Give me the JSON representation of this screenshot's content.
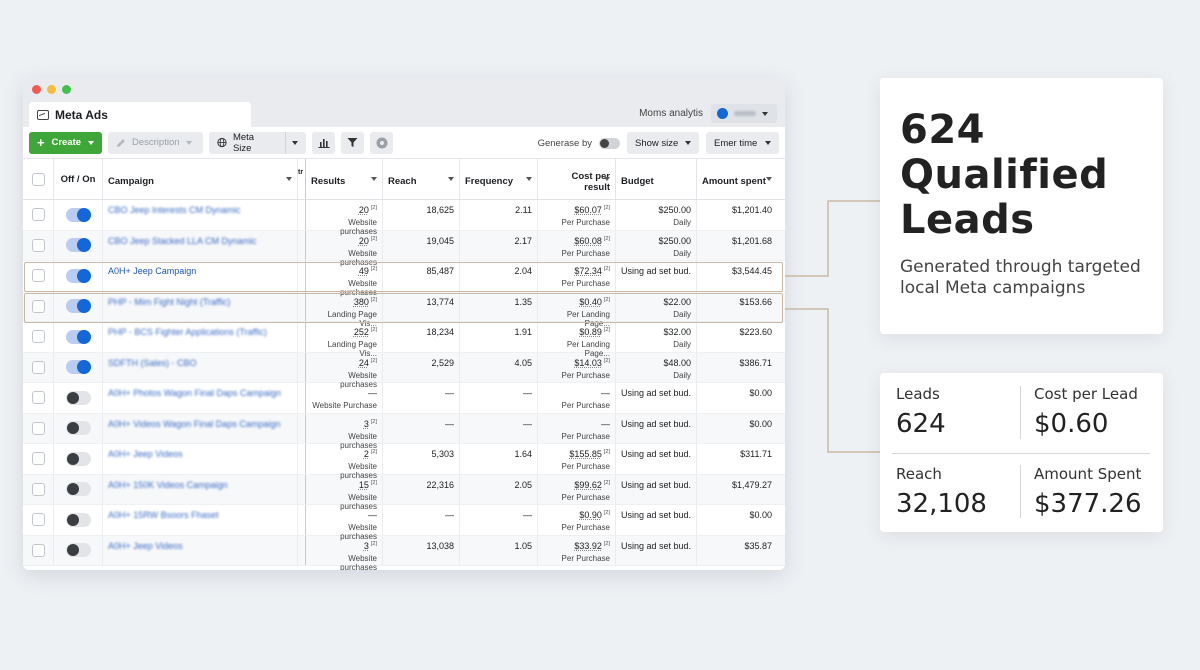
{
  "window": {
    "tab_title": "Meta Ads",
    "account_label": "Moms analytis"
  },
  "toolbar": {
    "create_label": "Create",
    "description_label": "Description",
    "meta_size_label": "Meta Size",
    "generase_label": "Generase by",
    "show_size_label": "Show size",
    "emer_time_label": "Emer time"
  },
  "table": {
    "columns": {
      "onoff": "Off / On",
      "campaign": "Campaign",
      "narrow": "tr",
      "results": "Results",
      "reach": "Reach",
      "frequency": "Frequency",
      "cpr": "Cost per result",
      "budget": "Budget",
      "amount": "Amount spent"
    },
    "rows": [
      {
        "on": true,
        "campaign": "CBO Jeep Interests CM Dynamic",
        "blur": true,
        "results": "20",
        "results_sub": "Website purchases",
        "reach": "18,625",
        "frequency": "2.11",
        "cpr": "$60.07",
        "cpr_sub": "Per Purchase",
        "budget": "$250.00",
        "budget_sub": "Daily",
        "amount": "$1,201.40"
      },
      {
        "on": true,
        "campaign": "CBO Jeep Stacked LLA CM Dynamic",
        "blur": true,
        "results": "20",
        "results_sub": "Website purchases",
        "reach": "19,045",
        "frequency": "2.17",
        "cpr": "$60.08",
        "cpr_sub": "Per Purchase",
        "budget": "$250.00",
        "budget_sub": "Daily",
        "amount": "$1,201.68"
      },
      {
        "on": true,
        "campaign": "A0H+ Jeep Campaign",
        "blur": false,
        "results": "49",
        "results_sub": "Website purchases",
        "reach": "85,487",
        "frequency": "2.04",
        "cpr": "$72.34",
        "cpr_sub": "Per Purchase",
        "budget": "Using ad set bud...",
        "budget_sub": "",
        "amount": "$3,544.45"
      },
      {
        "on": true,
        "campaign": "PHP - Mim Fight Night (Traffic)",
        "blur": true,
        "results": "380",
        "results_sub": "Landing Page Vis...",
        "reach": "13,774",
        "frequency": "1.35",
        "cpr": "$0.40",
        "cpr_sub": "Per Landing Page...",
        "budget": "$22.00",
        "budget_sub": "Daily",
        "amount": "$153.66"
      },
      {
        "on": true,
        "campaign": "PHP - BCS Fighter Applications (Traffic)",
        "blur": true,
        "results": "252",
        "results_sub": "Landing Page Vis...",
        "reach": "18,234",
        "frequency": "1.91",
        "cpr": "$0.89",
        "cpr_sub": "Per Landing Page...",
        "budget": "$32.00",
        "budget_sub": "Daily",
        "amount": "$223.60"
      },
      {
        "on": true,
        "campaign": "SDFTH (Sales) - CBO",
        "blur": true,
        "results": "24",
        "results_sub": "Website purchases",
        "reach": "2,529",
        "frequency": "4.05",
        "cpr": "$14.03",
        "cpr_sub": "Per Purchase",
        "budget": "$48.00",
        "budget_sub": "Daily",
        "amount": "$386.71"
      },
      {
        "on": false,
        "campaign": "A0H+ Photos Wagon Final Daps Campaign",
        "blur": true,
        "results": "—",
        "results_sub": "Website Purchase",
        "reach": "—",
        "frequency": "—",
        "cpr": "—",
        "cpr_sub": "Per Purchase",
        "budget": "Using ad set bud...",
        "budget_sub": "",
        "amount": "$0.00"
      },
      {
        "on": false,
        "campaign": "A0H+ Videos Wagon Final Daps Campaign",
        "blur": true,
        "results": "3",
        "results_sub": "Website purchases",
        "reach": "—",
        "frequency": "—",
        "cpr": "—",
        "cpr_sub": "Per Purchase",
        "budget": "Using ad set bud...",
        "budget_sub": "",
        "amount": "$0.00"
      },
      {
        "on": false,
        "campaign": "A0H+ Jeep Videos",
        "blur": true,
        "results": "2",
        "results_sub": "Website purchases",
        "reach": "5,303",
        "frequency": "1.64",
        "cpr": "$155.85",
        "cpr_sub": "Per Purchase",
        "budget": "Using ad set bud...",
        "budget_sub": "",
        "amount": "$311.71"
      },
      {
        "on": false,
        "campaign": "A0H+ 150K Videos Campaign",
        "blur": true,
        "results": "15",
        "results_sub": "Website purchases",
        "reach": "22,316",
        "frequency": "2.05",
        "cpr": "$99.62",
        "cpr_sub": "Per Purchase",
        "budget": "Using ad set bud...",
        "budget_sub": "",
        "amount": "$1,479.27"
      },
      {
        "on": false,
        "campaign": "A0H+ 15RW Bsoors Fhaset",
        "blur": true,
        "results": "—",
        "results_sub": "Website purchases",
        "reach": "—",
        "frequency": "—",
        "cpr": "$0.90",
        "cpr_sub": "Per Purchase",
        "budget": "Using ad set bud...",
        "budget_sub": "",
        "amount": "$0.00"
      },
      {
        "on": false,
        "campaign": "A0H+ Jeep Videos",
        "blur": true,
        "results": "3",
        "results_sub": "Website purchases",
        "reach": "13,038",
        "frequency": "1.05",
        "cpr": "$33.92",
        "cpr_sub": "Per Purchase",
        "budget": "Using ad set bud...",
        "budget_sub": "",
        "amount": "$35.87"
      }
    ]
  },
  "callout": {
    "big_number": "624",
    "big_line2": "Qualified",
    "big_line3": "Leads",
    "subtitle": "Generated through targeted local Meta campaigns"
  },
  "stats": {
    "leads_label": "Leads",
    "leads_value": "624",
    "cpl_label": "Cost per Lead",
    "cpl_value": "$0.60",
    "reach_label": "Reach",
    "reach_value": "32,108",
    "spent_label": "Amount Spent",
    "spent_value": "$377.26"
  },
  "colors": {
    "create_green": "#3fa63a",
    "toggle_blue": "#1467d8",
    "link_blue": "#1f57b8",
    "highlight": "#c9b9a4"
  }
}
